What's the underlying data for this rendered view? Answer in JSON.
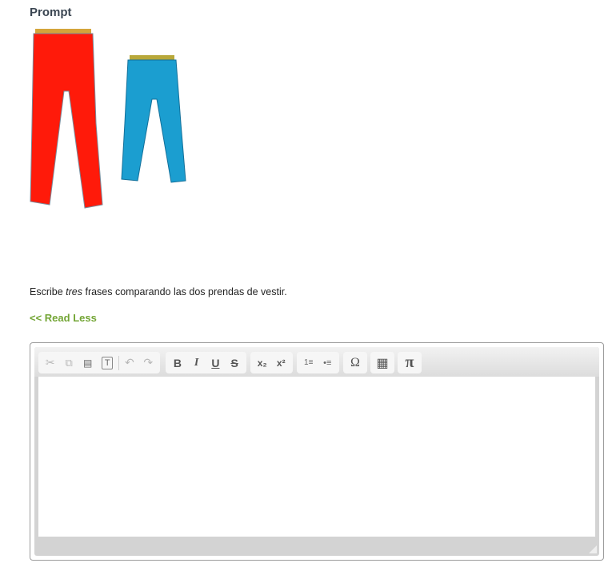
{
  "prompt": {
    "title": "Prompt",
    "image_alt": "Red trousers and blue jeans",
    "instructions_pre": "Escribe ",
    "instructions_em": "tres",
    "instructions_post": " frases comparando las dos prendas de vestir.",
    "read_less_label": "<< Read Less"
  },
  "editor": {
    "content": "",
    "toolbar": {
      "cut": "✂",
      "copy": "⧉",
      "paste": "📋",
      "paste_text": "T",
      "undo": "↶",
      "redo": "↷",
      "bold": "B",
      "italic": "I",
      "underline": "U",
      "strike": "S",
      "subscript": "x₂",
      "superscript": "x²",
      "numbered_list": "1≡",
      "bulleted_list": "•≡",
      "special_char": "Ω",
      "table": "▦",
      "math": "π"
    }
  }
}
